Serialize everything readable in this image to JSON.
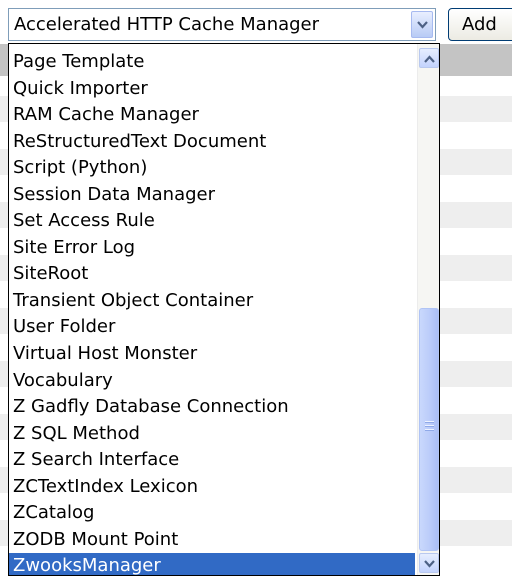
{
  "select": {
    "value": "Accelerated HTTP Cache Manager"
  },
  "add_button": {
    "label": "Add"
  },
  "dropdown": {
    "items": [
      "Page Template",
      "Quick Importer",
      "RAM Cache Manager",
      "ReStructuredText Document",
      "Script (Python)",
      "Session Data Manager",
      "Set Access Rule",
      "Site Error Log",
      "SiteRoot",
      "Transient Object Container",
      "User Folder",
      "Virtual Host Monster",
      "Vocabulary",
      "Z Gadfly Database Connection",
      "Z SQL Method",
      "Z Search Interface",
      "ZCTextIndex Lexicon",
      "ZCatalog",
      "ZODB Mount Point",
      "ZwooksManager"
    ],
    "highlighted_item": "ZwooksManager",
    "scroll_position": 1.0
  },
  "colors": {
    "selection_bg": "#316ac5",
    "selection_text": "#ffffff",
    "header_band": "#c4c4c4",
    "stripe": "#eeeeee"
  },
  "icons": {
    "select_arrow": "chevron-down-icon",
    "scroll_up": "chevron-up-icon",
    "scroll_down": "chevron-down-icon"
  }
}
